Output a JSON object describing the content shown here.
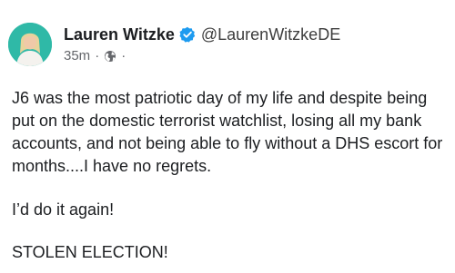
{
  "author": {
    "name": "Lauren Witzke",
    "handle": "@LaurenWitzkeDE",
    "verified": true,
    "time": "35m",
    "dot": "·",
    "audience_icon": "globe-icon"
  },
  "post": {
    "paragraph1": "J6 was the most patriotic day of my life and despite being put on the domestic terrorist watchlist, losing all my bank accounts, and not being able to fly without a DHS escort for months....I have no regrets.",
    "paragraph2": "I’d do it again!",
    "paragraph3": "STOLEN ELECTION!"
  },
  "colors": {
    "avatar_bg": "#2fb9a7",
    "verified_blue": "#1d9bf0",
    "meta_gray": "#65676b"
  }
}
